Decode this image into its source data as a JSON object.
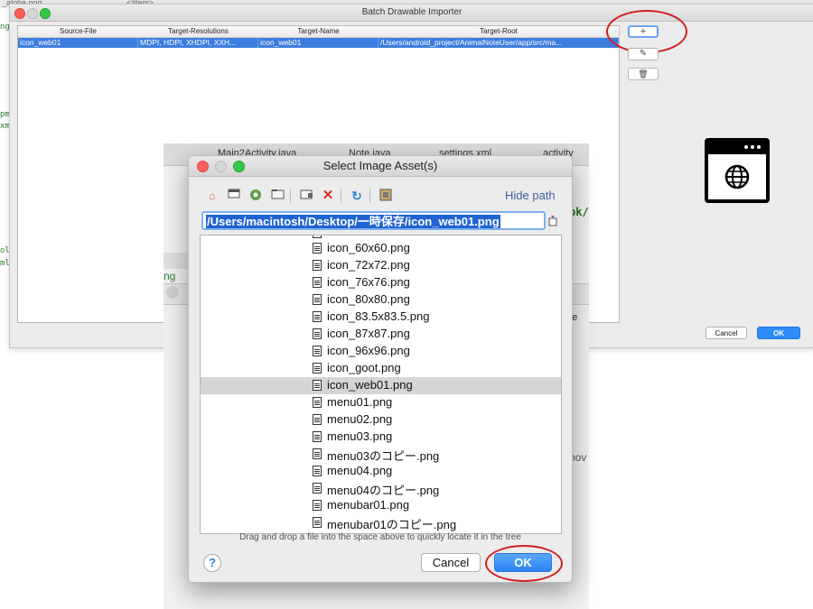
{
  "background": {
    "top_left_text": "_alpha.png",
    "top_mid_text": "</item>",
    "left_code": [
      "ng",
      "pm",
      "xm",
      "ol",
      "ml",
      "ml"
    ],
    "right_fragment_1": "pk/",
    "right_fragment_2": "ne",
    "right_fragment_3": "hov",
    "right_fragment_4": "ng"
  },
  "batch_importer": {
    "title": "Batch Drawable Importer",
    "columns": [
      "Source-File",
      "Target-Resolutions",
      "Target-Name",
      "Target-Root"
    ],
    "row": [
      "icon_web01",
      "MDPI, HDPI, XHDPI, XXH...",
      "icon_web01",
      "/Users/android_project/AnimalNoteUser/app/src/ma..."
    ],
    "add_label": "+",
    "edit_label": "✎",
    "delete_label": "🗑",
    "cancel_label": "Cancel",
    "ok_label": "OK"
  },
  "studio": {
    "tabs": [
      "Main2Activity.java",
      "Note.java",
      "settings.xml",
      "activity"
    ]
  },
  "dialog": {
    "title": "Select Image Asset(s)",
    "hide_path_label": "Hide path",
    "path_value": "/Users/macintosh/Desktop/一時保存/icon_web01.png",
    "files": [
      "icon_60x60.png",
      "icon_72x72.png",
      "icon_76x76.png",
      "icon_80x80.png",
      "icon_83.5x83.5.png",
      "icon_87x87.png",
      "icon_96x96.png",
      "icon_goot.png",
      "icon_web01.png",
      "menu01.png",
      "menu02.png",
      "menu03.png",
      "menu03のコピー.png",
      "menu04.png",
      "menu04のコピー.png",
      "menubar01.png",
      "menubar01のコピー.png"
    ],
    "selected_file": "icon_web01.png",
    "hint": "Drag and drop a file into the space above to quickly locate it in the tree",
    "help_label": "?",
    "cancel_label": "Cancel",
    "ok_label": "OK"
  },
  "icons": {
    "toolbar": [
      "home-icon",
      "desktop-icon",
      "project-icon",
      "folder-icon",
      "new-folder-icon",
      "delete-icon",
      "refresh-icon",
      "show-hidden-icon"
    ],
    "side": "browser-window-globe-icon"
  },
  "colors": {
    "selection_blue": "#3b7ddd",
    "ok_blue": "#2a83f5",
    "annotation_red": "#d0201f"
  }
}
